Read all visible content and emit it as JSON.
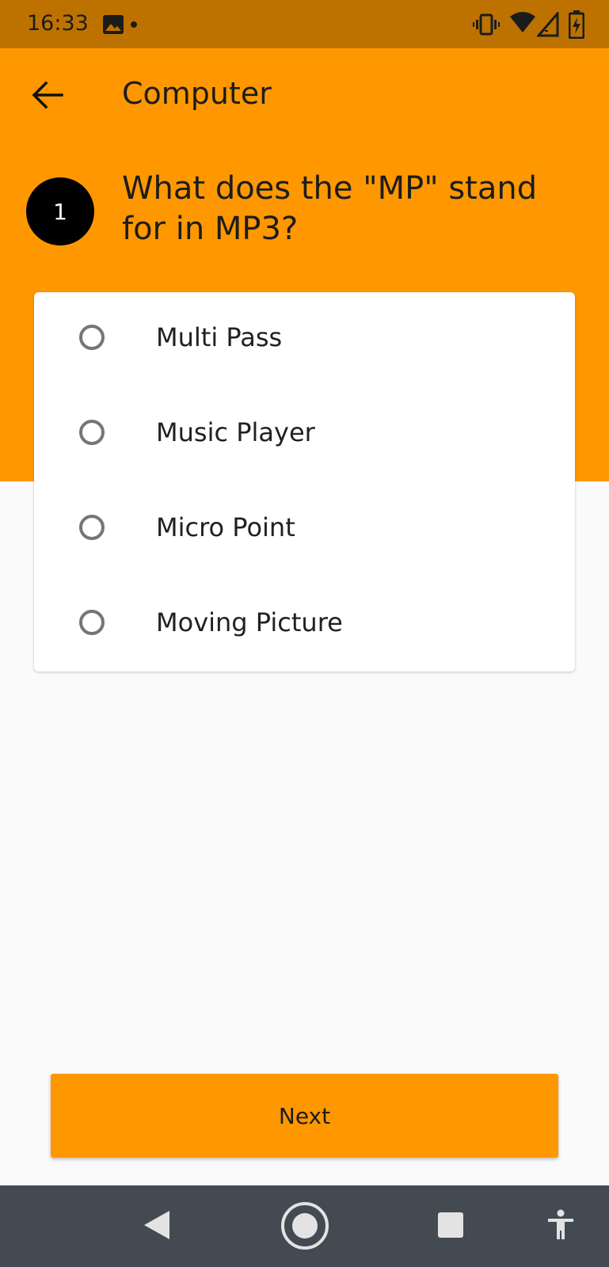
{
  "status_bar": {
    "time": "16:33"
  },
  "toolbar": {
    "title": "Computer"
  },
  "question": {
    "number": "1",
    "text": "What does the \"MP\" stand for in MP3?"
  },
  "options": [
    {
      "label": "Multi Pass",
      "selected": false
    },
    {
      "label": "Music Player",
      "selected": false
    },
    {
      "label": "Micro Point",
      "selected": false
    },
    {
      "label": "Moving Picture",
      "selected": false
    }
  ],
  "next_button": {
    "label": "Next"
  },
  "icons": {
    "back": "arrow-back-icon",
    "gallery": "image-icon",
    "vibrate": "vibrate-icon",
    "wifi": "wifi-icon",
    "signal": "signal-icon",
    "battery": "battery-charging-icon",
    "nav_back": "nav-back-icon",
    "nav_home": "nav-home-icon",
    "nav_recents": "nav-recents-icon",
    "accessibility": "accessibility-icon"
  },
  "colors": {
    "status_bar": "#BD7200",
    "accent": "#FF9800",
    "background": "#FAFAFA",
    "nav_bar": "#434A51"
  }
}
